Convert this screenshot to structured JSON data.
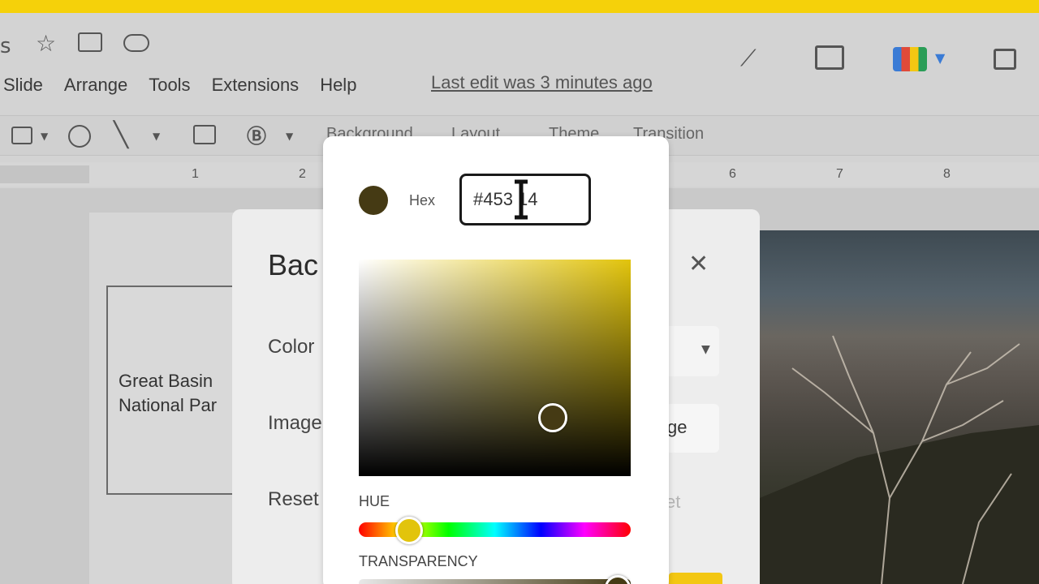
{
  "app": {
    "accent": "#f5d10a"
  },
  "menu": {
    "items": [
      "Slide",
      "Arrange",
      "Tools",
      "Extensions",
      "Help"
    ],
    "last_edit": "Last edit was 3 minutes ago"
  },
  "toolbar": {
    "background": "Background",
    "layout": "Layout",
    "theme": "Theme",
    "transition": "Transition"
  },
  "ruler": {
    "ticks": [
      "1",
      "2",
      "6",
      "7",
      "8"
    ]
  },
  "slide": {
    "line1": "Great Basin",
    "line2": "National Par"
  },
  "background_dialog": {
    "title": "Bac",
    "color_label": "Color",
    "image_label": "Image",
    "reset_label": "Reset",
    "image_button": "ge",
    "reset_ghost": "et",
    "close_icon": "close-icon"
  },
  "color_picker": {
    "swatch_color": "#453a14",
    "hex_label": "Hex",
    "hex_value": "#453 14",
    "hue_label": "HUE",
    "hue_color": "#e2c40c",
    "transparency_label": "TRANSPARENCY",
    "hue_level": 0.19,
    "transparency_level": 0.95
  },
  "icons": [
    "star-icon",
    "move-to-folder-icon",
    "cloud-status-icon",
    "trend-icon",
    "comment-icon",
    "meet-icon",
    "present-icon"
  ]
}
